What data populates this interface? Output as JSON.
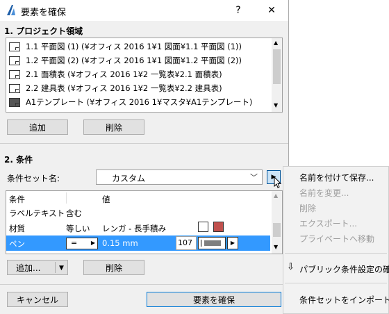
{
  "window": {
    "title": "要素を確保",
    "help_label": "?",
    "close_label": "✕"
  },
  "section1": {
    "title": "1. プロジェクト領域",
    "items": [
      {
        "label": "1.1 平面図 (1) (¥オフィス 2016 1¥1 図面¥1.1 平面図 (1))",
        "icon": "plan-icon"
      },
      {
        "label": "1.2 平面図 (2) (¥オフィス 2016 1¥1 図面¥1.2 平面図 (2))",
        "icon": "plan-icon"
      },
      {
        "label": "2.1 面積表 (¥オフィス 2016 1¥2 一覧表¥2.1 面積表)",
        "icon": "schedule-icon"
      },
      {
        "label": "2.2 建具表 (¥オフィス 2016 1¥2 一覧表¥2.2 建具表)",
        "icon": "schedule-icon"
      },
      {
        "label": "A1テンプレート (¥オフィス 2016 1¥マスタ¥A1テンプレート)",
        "icon": "master-layout-icon"
      }
    ],
    "add_label": "追加",
    "delete_label": "削除"
  },
  "section2": {
    "title": "2. 条件",
    "set_name_label": "条件セット名:",
    "set_name_value": "カスタム",
    "table": {
      "headers": [
        "条件",
        "値"
      ],
      "rows": [
        {
          "name": "ラベルテキスト",
          "op": "含む",
          "value": ""
        },
        {
          "name": "材質",
          "op": "等しい",
          "value": "レンガ - 長手積み"
        },
        {
          "name": "ペン",
          "op": "=",
          "value": "0.15 mm",
          "pen_number": "107"
        }
      ]
    },
    "add_label": "追加...",
    "delete_label": "削除"
  },
  "footer": {
    "cancel_label": "キャンセル",
    "ok_label": "要素を確保"
  },
  "popup_menu": {
    "items": [
      {
        "label": "名前を付けて保存...",
        "enabled": true
      },
      {
        "label": "名前を変更...",
        "enabled": false
      },
      {
        "label": "削除",
        "enabled": false
      },
      {
        "label": "エクスポート...",
        "enabled": false
      },
      {
        "label": "プライベートへ移動",
        "enabled": false
      },
      {
        "label": "パブリック条件設定の確保",
        "enabled": true
      },
      {
        "label": "条件セットをインポート...",
        "enabled": true
      }
    ]
  },
  "colors": {
    "selection": "#3399ff",
    "brick_swatch": "#c0504d",
    "accent": "#0078d7"
  }
}
